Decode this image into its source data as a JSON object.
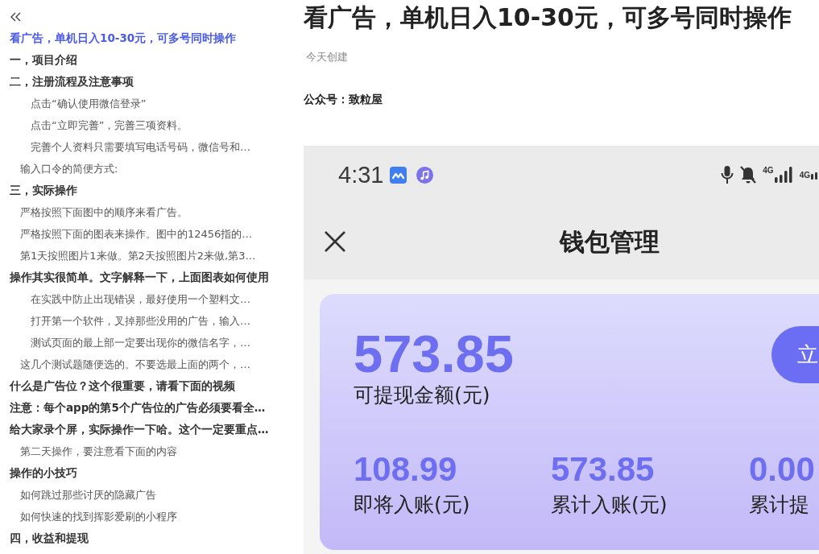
{
  "outline": {
    "items": [
      {
        "text": "看广告，单机日入10-30元，可多号同时操作",
        "selected": true
      },
      {
        "text": "一，项目介绍",
        "selected": false
      },
      {
        "text": "二，注册流程及注意事项",
        "selected": false,
        "children": [
          {
            "text": "点击“确认使用微信登录”",
            "kind": "h3",
            "selected": false
          },
          {
            "text": "点击“立即完善”，完善三项资料。",
            "kind": "h3",
            "selected": false
          },
          {
            "text": "完善个人资料只需要填写电话号码，微信号和…",
            "kind": "h3",
            "selected": false
          },
          {
            "text": "输入口令的简便方式:",
            "kind": "h2",
            "selected": false
          }
        ]
      },
      {
        "text": "三，实际操作",
        "selected": false,
        "children": [
          {
            "text": "严格按照下面图中的顺序来看广告。",
            "kind": "h2",
            "selected": false
          },
          {
            "text": "严格按照下面的图表来操作。图中的12456指的…",
            "kind": "h2",
            "selected": false
          },
          {
            "text": "第1天按照图片1来做。第2天按照图片2来做,第3…",
            "kind": "h2",
            "selected": false
          }
        ]
      },
      {
        "text": "操作其实很简单。文字解释一下，上面图表如何使用",
        "selected": false,
        "children": [
          {
            "text": "在实践中防止出现错误，最好使用一个塑料文…",
            "kind": "h3",
            "selected": false
          },
          {
            "text": "打开第一个软件，叉掉那些没用的广告，输入…",
            "kind": "h3",
            "selected": false
          },
          {
            "text": "测试页面的最上部一定要出现你的微信名字，…",
            "kind": "h3",
            "selected": false
          },
          {
            "text": "这几个测试题随便选的。不要选最上面的两个，…",
            "kind": "h2",
            "selected": false
          }
        ]
      },
      {
        "text": "什么是广告位？这个很重要，请看下面的视频",
        "selected": false
      },
      {
        "text": "注意：每个app的第5个广告位的广告必须要看全…",
        "selected": false
      },
      {
        "text": "给大家录个屏，实际操作一下哈。这个一定要重点…",
        "selected": false,
        "children": [
          {
            "text": "第二天操作，要注意看下面的内容",
            "kind": "h2",
            "selected": false
          }
        ]
      },
      {
        "text": "操作的小技巧",
        "selected": false,
        "children": [
          {
            "text": "如何跳过那些讨厌的隐藏广告",
            "kind": "h2",
            "selected": false
          },
          {
            "text": "如何快速的找到挥影爱刷的小程序",
            "kind": "h2",
            "selected": false
          }
        ]
      },
      {
        "text": "四，收益和提现",
        "selected": false
      }
    ]
  },
  "document": {
    "title": "看广告，单机日入10-30元，可多号同时操作",
    "created": "今天创建",
    "paragraphs": [
      "公众号：致粒屋"
    ]
  },
  "screenshot": {
    "status_bar": {
      "time": "4:31",
      "network_labels": [
        "4G",
        "4G"
      ]
    },
    "title_bar": {
      "title": "钱包管理"
    },
    "wallet_card": {
      "amount": "573.85",
      "amount_label": "可提现金额(元)",
      "button": "立",
      "stats": [
        {
          "value": "108.99",
          "label": "即将入账(元)"
        },
        {
          "value": "573.85",
          "label": "累计入账(元)"
        },
        {
          "value": "0.00",
          "label": "累计提"
        }
      ]
    }
  }
}
